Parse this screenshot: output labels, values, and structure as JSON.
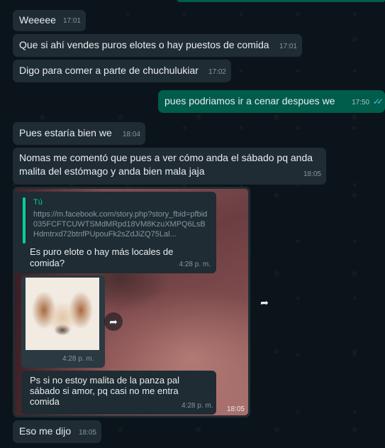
{
  "messages": [
    {
      "id": "m1",
      "dir": "in",
      "text": "Weeeee",
      "time": "17:01"
    },
    {
      "id": "m2",
      "dir": "in",
      "text": "Que si ahí vendes puros elotes o hay puestos de comida",
      "time": "17:01"
    },
    {
      "id": "m3",
      "dir": "in",
      "text": "Digo para comer a parte de chuchulukiar",
      "time": "17:02"
    },
    {
      "id": "m4",
      "dir": "out",
      "text": "pues podriamos ir a cenar despues we",
      "time": "17:50",
      "status": "read"
    },
    {
      "id": "m5",
      "dir": "in",
      "text": "Pues estaría bien we",
      "time": "18:04"
    },
    {
      "id": "m6",
      "dir": "in",
      "text": "Nomas me comentó que pues a ver cómo anda el sábado pq anda malita del estómago y anda bien mala jaja",
      "time": "18:05"
    },
    {
      "id": "m8",
      "dir": "in",
      "text": "Eso me dijo",
      "time": "18:05"
    }
  ],
  "image_message": {
    "time": "18:05",
    "quoted": {
      "author": "Tú",
      "link": "https://m.facebook.com/story.php?story_fbid=pfbid035FCFTCUWTSMdMRpd18VM8KzuXMPQ6LsBHdmtrxd72btnfPUpouFk2sZdJiZQ75Lal...",
      "text": "Es puro elote o hay más locales de comida?",
      "time": "4:28 p. m."
    },
    "sticker_time": "4:28 p. m.",
    "reply": {
      "text": "Ps si no estoy malita de la panza pal sábado si amor, pq casi no me entra comida",
      "time": "4:28 p. m."
    }
  },
  "icons": {
    "forward": "forward-icon",
    "read_ticks": "double-check-icon"
  },
  "colors": {
    "incoming": "#202c33",
    "outgoing": "#005c4b",
    "background": "#0b141a",
    "read": "#53bdeb"
  }
}
